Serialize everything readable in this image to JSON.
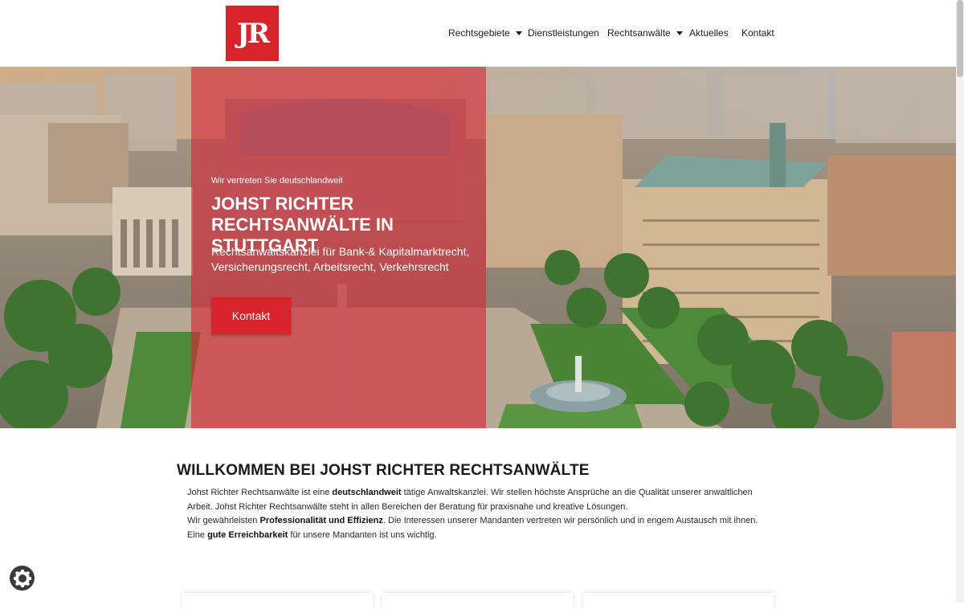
{
  "header": {
    "logo_text": "JR",
    "nav": [
      {
        "label": "Rechtsgebiete",
        "dropdown": true
      },
      {
        "label": "Dienstleistungen",
        "dropdown": false
      },
      {
        "label": "Rechtsanwälte",
        "dropdown": true
      },
      {
        "label": "Aktuelles",
        "dropdown": false
      },
      {
        "label": "Kontakt",
        "dropdown": false
      }
    ]
  },
  "hero": {
    "kicker": "Wir vertreten Sie deutschlandweit",
    "title": "Johst Richter Rechtsanwälte in Stuttgart",
    "subtitle": "Rechtsanwaltskanzlei für Bank-& Kapitalmarktrecht, Versicherungsrecht, Arbeitsrecht, Verkehrsrecht",
    "button_label": "Kontakt",
    "overlay_color": "#d8232a"
  },
  "welcome": {
    "heading": "Willkommen bei Johst Richter Rechtsanwälte",
    "p1_a": "Johst Richter Rechtsanwälte ist eine ",
    "p1_b": "deutschlandweit",
    "p1_c": " tätige Anwaltskanzlei.  Wir stellen höchste Ansprüche an die Qualität unserer anwaltlichen Arbeit. Johst Richter Rechtsanwälte steht in allen Bereichen der Beratung für praxisnahe und kreative Lösungen.",
    "p2_a": "Wir gewährleisten ",
    "p2_b": "Professionalität und Effizienz",
    "p2_c": ". Die Interessen unserer Mandanten vertreten wir persönlich und in engem Austausch mit ihnen.",
    "p3_a": "Eine ",
    "p3_b": "gute Erreichbarkeit",
    "p3_c": " für unsere Mandanten ist uns wichtig."
  },
  "icons": {
    "cookie": "cookie-icon",
    "dropdown": "chevron-down-icon"
  },
  "colors": {
    "brand_red": "#d8232a"
  }
}
